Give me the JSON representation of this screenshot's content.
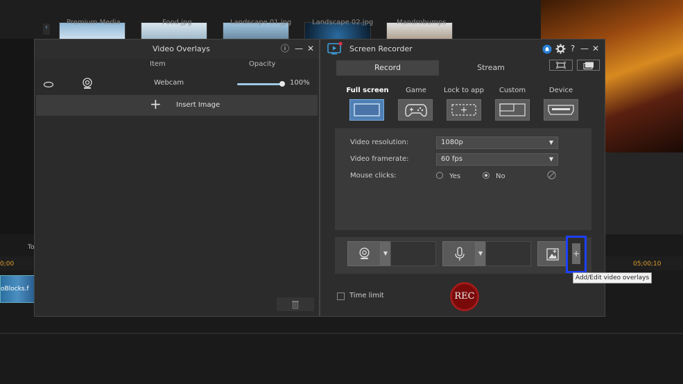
{
  "background": {
    "media_thumbs": [
      "Premium Media",
      "Food.jpg",
      "Landscape 01.jpg",
      "Landscape 02.jpg",
      "Mandrobumps"
    ],
    "timeline": {
      "track_label": "To",
      "time_start": "0;00",
      "time_end": "05;00;10",
      "clip_label": "oBlocks.f"
    }
  },
  "overlays": {
    "title": "Video Overlays",
    "columns": {
      "item": "Item",
      "opacity": "Opacity"
    },
    "row": {
      "label": "Webcam",
      "opacity": "100%"
    },
    "insert_label": "Insert Image",
    "icons": {
      "info": "ⓘ",
      "minimize": "—",
      "close": "✕"
    }
  },
  "recorder": {
    "title": "Screen Recorder",
    "tabs": {
      "record": "Record",
      "stream": "Stream"
    },
    "modes": [
      "Full screen",
      "Game",
      "Lock to app",
      "Custom",
      "Device"
    ],
    "settings": {
      "resolution_label": "Video resolution:",
      "resolution_value": "1080p",
      "framerate_label": "Video framerate:",
      "framerate_value": "60 fps",
      "mouse_label": "Mouse clicks:",
      "yes": "Yes",
      "no": "No"
    },
    "time_limit": "Time limit",
    "rec": "REC",
    "tooltip": "Add/Edit video overlays",
    "icons": {
      "help": "?",
      "minimize": "—",
      "close": "✕"
    }
  }
}
